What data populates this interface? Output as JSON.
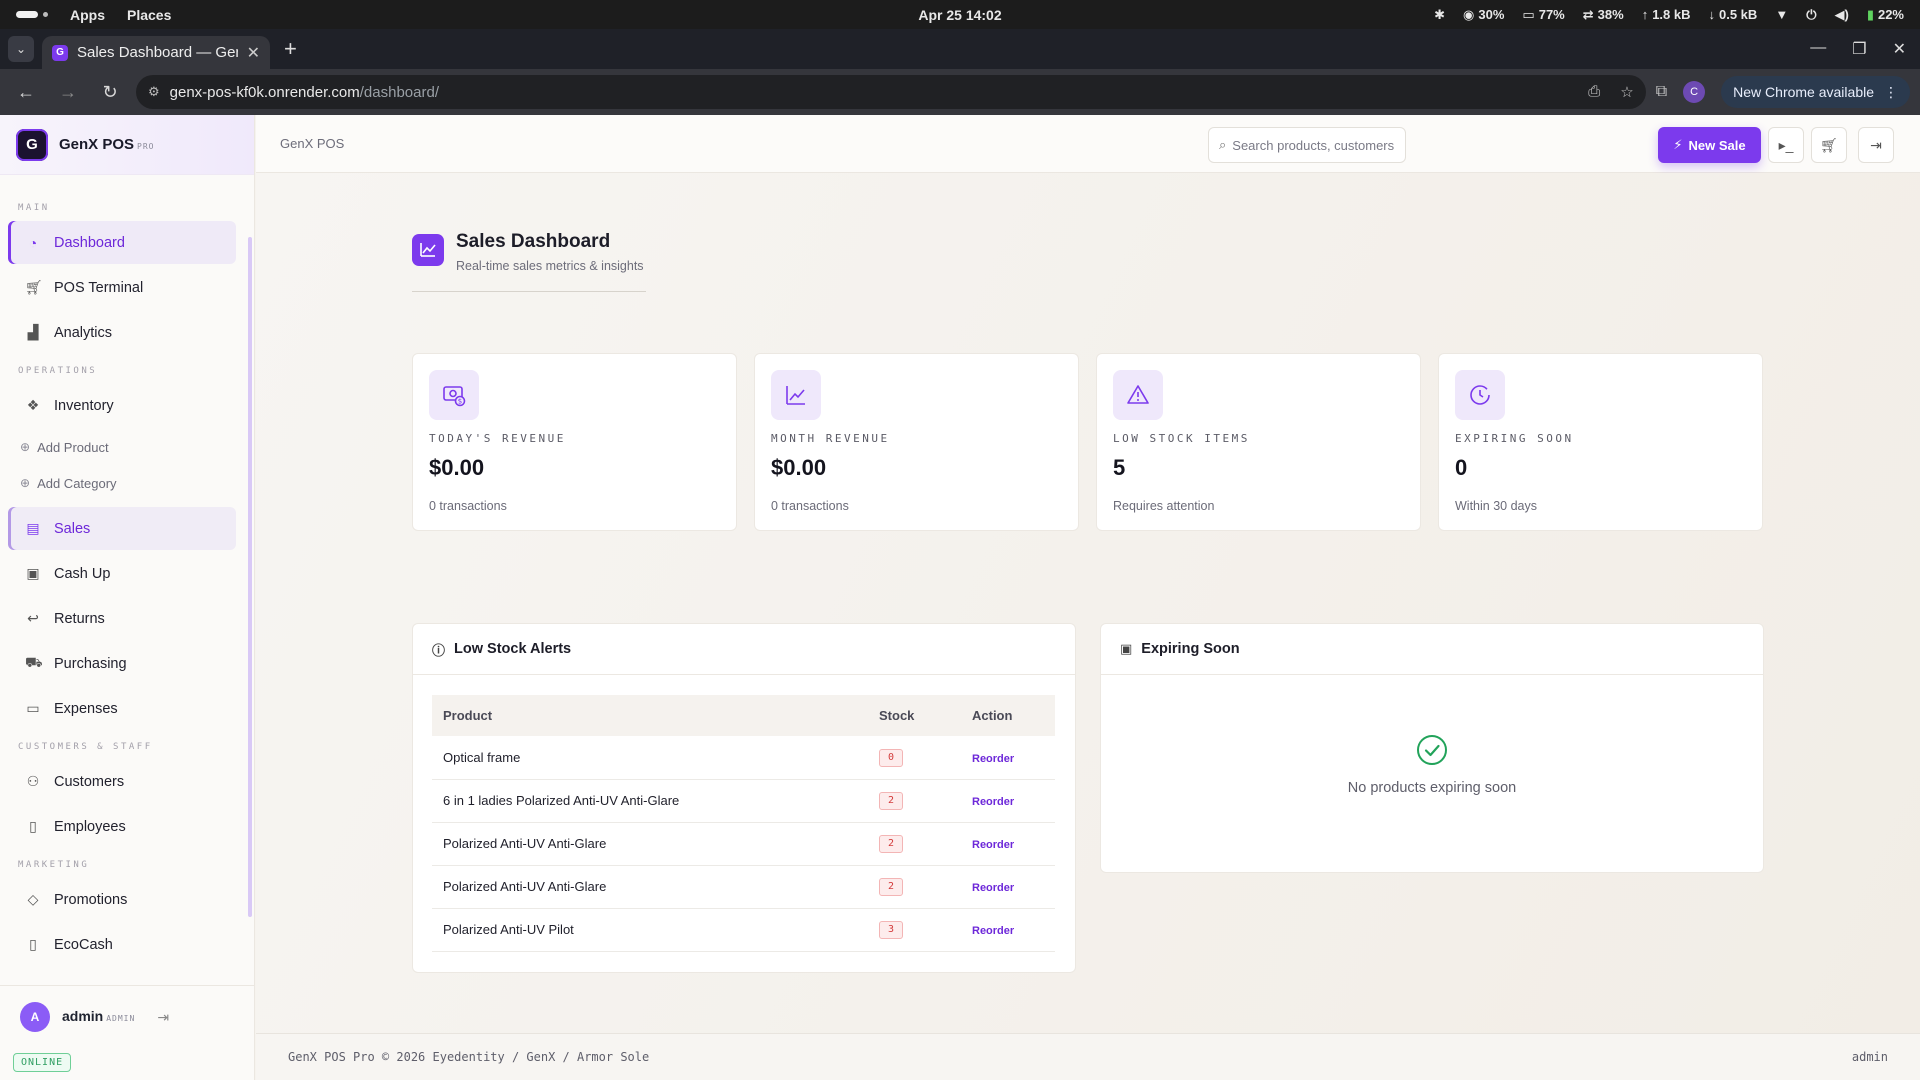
{
  "os": {
    "menus": [
      "Apps",
      "Places"
    ],
    "clock": "Apr 25  14:02",
    "stats": [
      "30%",
      "77%",
      "38%",
      "1.8 kB",
      "0.5 kB"
    ],
    "battery": "22%"
  },
  "browser": {
    "tab_title": "Sales Dashboard — GenX POS",
    "url_host": "genx-pos-kf0k.onrender.com",
    "url_path": "/dashboard/",
    "update_label": "New Chrome available",
    "profile_initial": "C"
  },
  "brand": {
    "logo_letter": "G",
    "name": "GenX POS",
    "tag": "PRO"
  },
  "sidebar": {
    "sections": {
      "main": "MAIN",
      "operations": "OPERATIONS",
      "customers": "CUSTOMERS & STAFF",
      "marketing": "MARKETING"
    },
    "items": {
      "dashboard": "Dashboard",
      "pos": "POS Terminal",
      "analytics": "Analytics",
      "inventory": "Inventory",
      "add_product": "Add Product",
      "add_category": "Add Category",
      "sales": "Sales",
      "cashup": "Cash Up",
      "returns": "Returns",
      "purchasing": "Purchasing",
      "expenses": "Expenses",
      "customers": "Customers",
      "employees": "Employees",
      "promotions": "Promotions",
      "ecocash": "EcoCash"
    },
    "user": {
      "initial": "A",
      "name": "admin",
      "role": "ADMIN",
      "status": "ONLINE"
    }
  },
  "header": {
    "crumb": "GenX POS",
    "search_placeholder": "Search products, customers...",
    "new_sale": "New Sale"
  },
  "page": {
    "title": "Sales Dashboard",
    "subtitle": "Real-time sales metrics & insights"
  },
  "stats": [
    {
      "label": "TODAY'S REVENUE",
      "value": "$0.00",
      "note": "0 transactions"
    },
    {
      "label": "MONTH REVENUE",
      "value": "$0.00",
      "note": "0 transactions"
    },
    {
      "label": "LOW STOCK ITEMS",
      "value": "5",
      "note": "Requires attention"
    },
    {
      "label": "EXPIRING SOON",
      "value": "0",
      "note": "Within 30 days"
    }
  ],
  "low_stock": {
    "title": "Low Stock Alerts",
    "columns": {
      "product": "Product",
      "stock": "Stock",
      "action": "Action"
    },
    "rows": [
      {
        "product": "Optical frame",
        "stock": "0",
        "action": "Reorder"
      },
      {
        "product": "6 in 1 ladies Polarized Anti-UV Anti-Glare",
        "stock": "2",
        "action": "Reorder"
      },
      {
        "product": "Polarized Anti-UV Anti-Glare",
        "stock": "2",
        "action": "Reorder"
      },
      {
        "product": "Polarized Anti-UV Anti-Glare",
        "stock": "2",
        "action": "Reorder"
      },
      {
        "product": "Polarized Anti-UV Pilot",
        "stock": "3",
        "action": "Reorder"
      }
    ]
  },
  "expiring": {
    "title": "Expiring Soon",
    "empty": "No products expiring soon"
  },
  "footer": {
    "left": "GenX POS Pro © 2026 Eyedentity / GenX / Armor Sole",
    "right": "admin"
  },
  "colors": {
    "accent": "#7c3aed",
    "danger": "#d33b3b",
    "success": "#22a35a"
  }
}
